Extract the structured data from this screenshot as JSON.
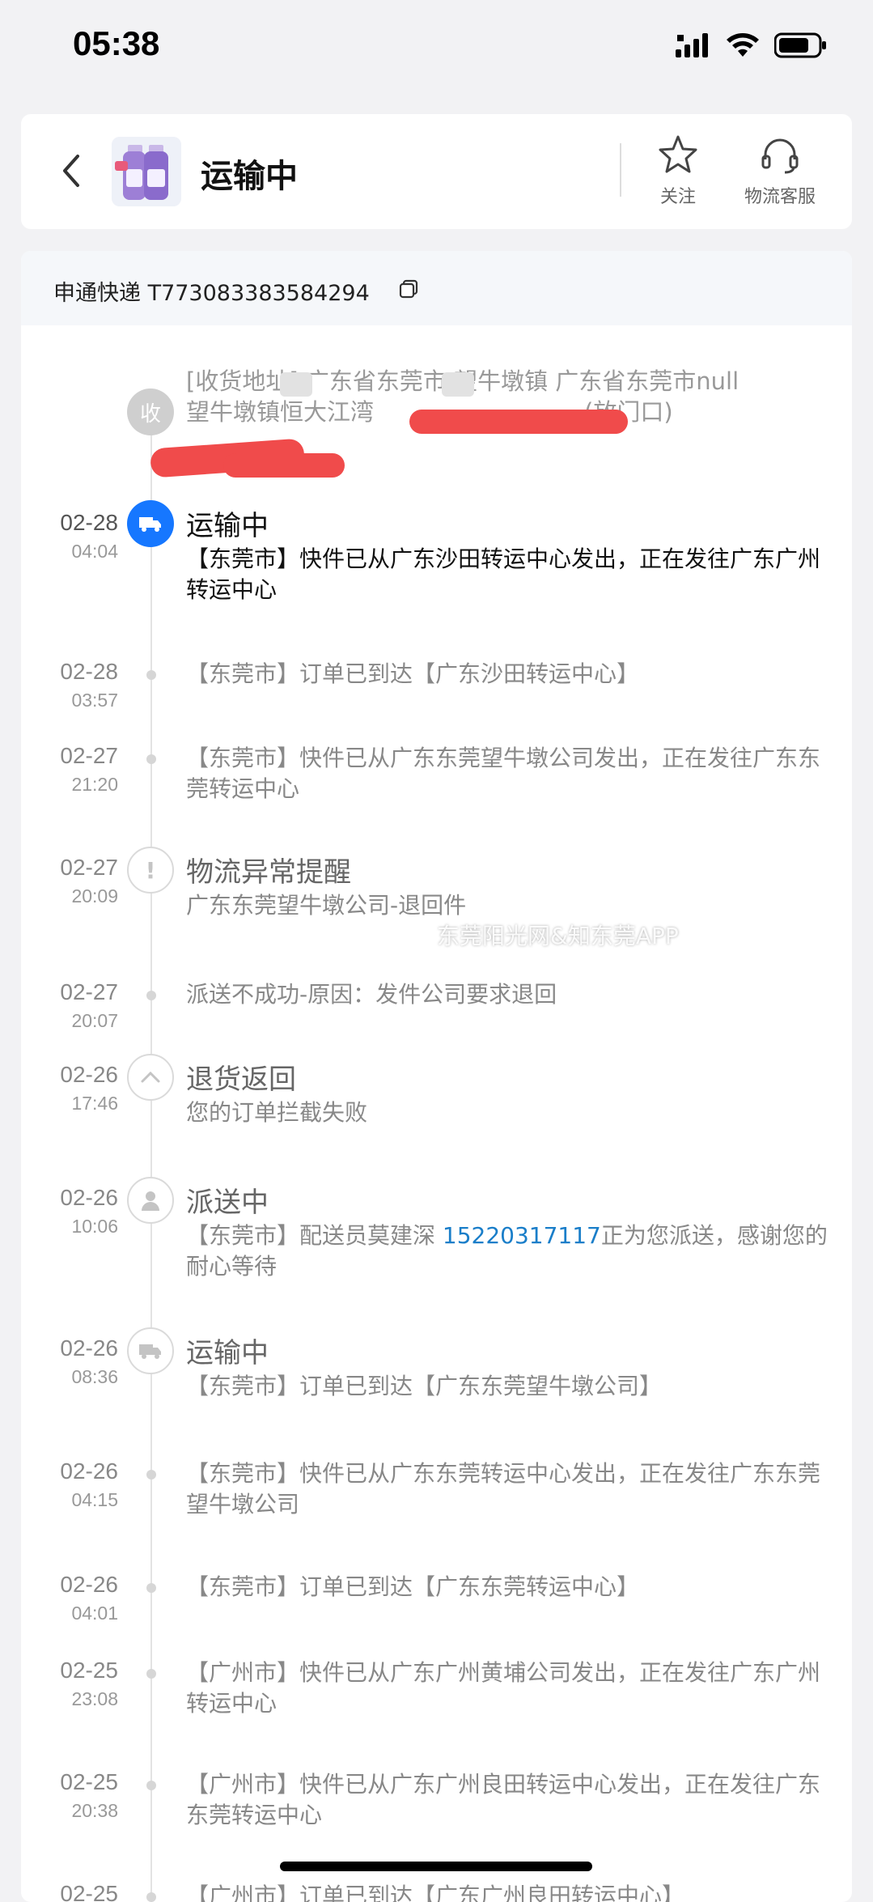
{
  "status_bar": {
    "time": "05:38"
  },
  "header": {
    "title": "运输中",
    "follow_label": "关注",
    "service_label": "物流客服"
  },
  "tracking": {
    "carrier_and_number": "申通快递 T773083383584294"
  },
  "address": {
    "badge": "收",
    "line1": "[收货地址] 广东省东莞市  望牛墩镇  广东省东莞市null",
    "line2_a": "望牛墩镇恒大江湾",
    "line2_b": "(放门口)"
  },
  "events": [
    {
      "date": "02-28",
      "time": "04:04",
      "title": "运输中",
      "desc": "【东莞市】快件已从广东沙田转运中心发出，正在发往广东广州转运中心"
    },
    {
      "date": "02-28",
      "time": "03:57",
      "desc": "【东莞市】订单已到达【广东沙田转运中心】"
    },
    {
      "date": "02-27",
      "time": "21:20",
      "desc": "【东莞市】快件已从广东东莞望牛墩公司发出，正在发往广东东莞转运中心"
    },
    {
      "date": "02-27",
      "time": "20:09",
      "title": "物流异常提醒",
      "desc": "广东东莞望牛墩公司-退回件"
    },
    {
      "date": "02-27",
      "time": "20:07",
      "desc": "派送不成功-原因：发件公司要求退回"
    },
    {
      "date": "02-26",
      "time": "17:46",
      "title": "退货返回",
      "desc": "您的订单拦截失败"
    },
    {
      "date": "02-26",
      "time": "10:06",
      "title": "派送中",
      "desc_a": "【东莞市】配送员莫建深 ",
      "phone": "15220317117",
      "desc_b": "正为您派送，感谢您的耐心等待"
    },
    {
      "date": "02-26",
      "time": "08:36",
      "title": "运输中",
      "desc": "【东莞市】订单已到达【广东东莞望牛墩公司】"
    },
    {
      "date": "02-26",
      "time": "04:15",
      "desc": "【东莞市】快件已从广东东莞转运中心发出，正在发往广东东莞望牛墩公司"
    },
    {
      "date": "02-26",
      "time": "04:01",
      "desc": "【东莞市】订单已到达【广东东莞转运中心】"
    },
    {
      "date": "02-25",
      "time": "23:08",
      "desc": "【广州市】快件已从广东广州黄埔公司发出，正在发往广东广州转运中心"
    },
    {
      "date": "02-25",
      "time": "20:38",
      "desc": "【广州市】快件已从广东广州良田转运中心发出，正在发往广东东莞转运中心"
    },
    {
      "date": "02-25",
      "desc": "【广州市】订单已到达【广东广州良田转运中心】"
    }
  ],
  "watermark": "东莞阳光网&知东莞APP",
  "colors": {
    "accent": "#1677ff",
    "link": "#1a7ec9",
    "redaction": "#f04b4b"
  }
}
